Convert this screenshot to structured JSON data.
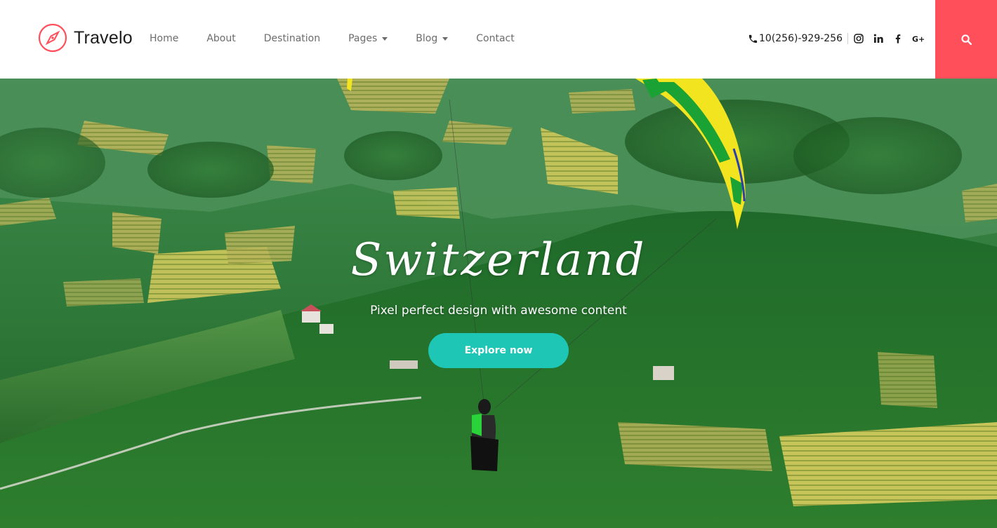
{
  "brand": {
    "name": "Travelo",
    "icon": "compass-icon",
    "color": "#ff4f5a"
  },
  "nav": [
    {
      "label": "Home",
      "dropdown": false
    },
    {
      "label": "About",
      "dropdown": false
    },
    {
      "label": "Destination",
      "dropdown": false
    },
    {
      "label": "Pages",
      "dropdown": true
    },
    {
      "label": "Blog",
      "dropdown": true
    },
    {
      "label": "Contact",
      "dropdown": false
    }
  ],
  "contact": {
    "phone": "10(256)-929-256",
    "phone_icon": "phone-icon",
    "social": [
      "instagram-icon",
      "linkedin-icon",
      "facebook-icon",
      "google-plus-icon"
    ]
  },
  "search": {
    "icon": "search-icon",
    "color": "#ff4f5a"
  },
  "hero": {
    "title": "Switzerland",
    "subtitle": "Pixel perfect design with awesome content",
    "button": "Explore now",
    "button_color": "#1ec6b6"
  }
}
